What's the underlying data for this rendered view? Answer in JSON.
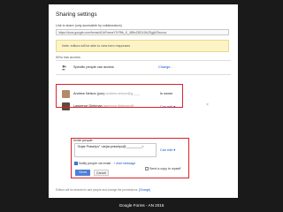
{
  "dialog": {
    "title": "Sharing settings",
    "link_label": "Link to share (only accessible by collaborators)",
    "link_value": "https://docs.google.com/forms/d/1kFmmaY3YRtb_K_48NxZ8GXJIbZ0gjbZ9cccoc",
    "note": "Note: editors will be able to view form responses"
  },
  "access": {
    "heading": "Who has access",
    "general": {
      "label": "Specific people can access",
      "change_label": "Change..."
    },
    "people": [
      {
        "name": "Andrew Nelson (you)",
        "email": "andrew.nelson@g____",
        "role": "Is owner"
      },
      {
        "name": "Lawrence Diebman",
        "email": "lawrence.diebman@_____",
        "role": "Can edit"
      }
    ],
    "remove_label": "×"
  },
  "invite": {
    "label": "Invite people:",
    "value": "\"Anjar Prasetyo\" <anjar.prasetyo@_________>",
    "permission": "Can edit",
    "notify_label": "Notify people via email -",
    "add_message_label": "+ Add message",
    "send_copy_label": "Send a copy to myself",
    "send_button": "Send",
    "cancel_button": "Cancel"
  },
  "footer": {
    "text": "Editors will be allowed to add people and change the permissions.",
    "change_label": "[Change]"
  },
  "caption": "Google Forms - AN 2015",
  "colors": {
    "accent": "#d9232d",
    "link": "#1155cc",
    "button": "#4d7fd6",
    "note_bg": "#fcf3c7"
  }
}
